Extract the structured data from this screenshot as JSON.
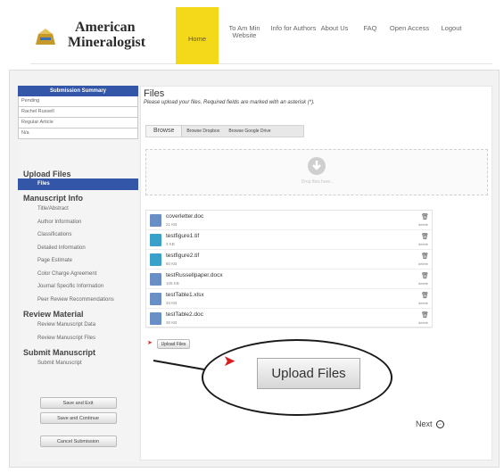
{
  "header": {
    "logo_line1": "American",
    "logo_line2": "Mineralogist",
    "nav": [
      {
        "label": "Home",
        "active": true
      },
      {
        "label": "To Am Min Website"
      },
      {
        "label": "Info for Authors"
      },
      {
        "label": "About Us"
      },
      {
        "label": "FAQ"
      },
      {
        "label": "Open Access"
      },
      {
        "label": "Logout"
      }
    ]
  },
  "sidebar": {
    "summary_title": "Submission Summary",
    "summary_rows": [
      "Pending",
      "Rachel Russell",
      "Regular Article",
      "N/a"
    ],
    "sections": [
      {
        "title": "Upload Files",
        "items": [
          "Files"
        ]
      },
      {
        "title": "Manuscript Info",
        "items": [
          "Title/Abstract",
          "Author Information",
          "Classifications",
          "Detailed Information",
          "Page Estimate",
          "Color Charge Agreement",
          "Journal Specific Information",
          "Peer Review Recommendations"
        ]
      },
      {
        "title": "Review Material",
        "items": [
          "Review Manuscript Data",
          "Review Manuscript Files"
        ]
      },
      {
        "title": "Submit Manuscript",
        "items": [
          "Submit Manuscript"
        ]
      }
    ],
    "buttons": [
      "Save and Exit",
      "Save and Continue",
      "Cancel Submission"
    ]
  },
  "main": {
    "title": "Files",
    "subtitle": "Please upload your files. Required fields are marked with an asterisk (*).",
    "browse_label": "Browse",
    "browse_dropbox": "Browse Dropbox",
    "browse_gdrive": "Browse Google Drive",
    "drop_label": "Drop files here...",
    "files": [
      {
        "name": "coverletter.doc",
        "size": "21 KB",
        "kind": "doc"
      },
      {
        "name": "testfigure1.tif",
        "size": "3 KB",
        "kind": "pic"
      },
      {
        "name": "testfigure2.tif",
        "size": "60 KB",
        "kind": "pic"
      },
      {
        "name": "testRussellpaper.docx",
        "size": "105 KB",
        "kind": "doc"
      },
      {
        "name": "testTable1.xlsx",
        "size": "34 KB",
        "kind": "doc"
      },
      {
        "name": "testTable2.doc",
        "size": "30 KB",
        "kind": "doc"
      }
    ],
    "delete_label": "delete",
    "upload_small": "Upload Files",
    "next_label": "Next"
  },
  "callout": {
    "upload_big": "Upload Files"
  },
  "colors": {
    "accent_yellow": "#f3d91a",
    "sidebar_blue": "#3456a8",
    "arrow_red": "#d91e1e"
  }
}
